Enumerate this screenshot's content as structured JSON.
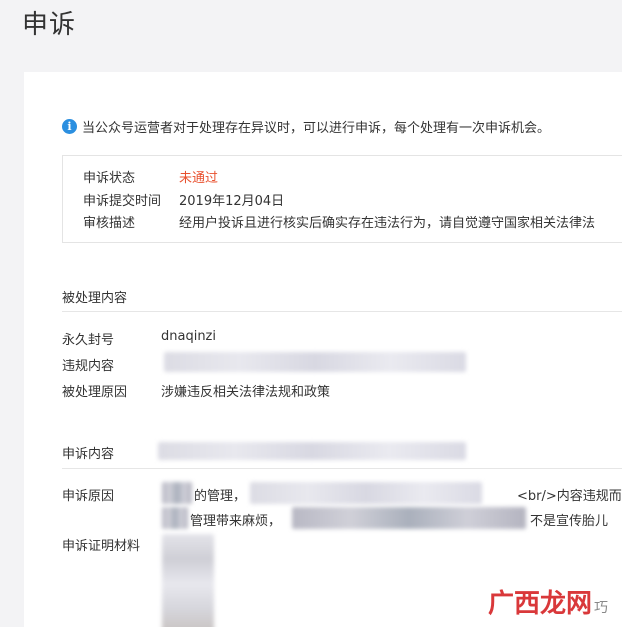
{
  "page": {
    "title": "申诉"
  },
  "notice": {
    "text": "当公众号运营者对于处理存在异议时，可以进行申诉，每个处理有一次申诉机会。"
  },
  "status_box": {
    "status_label": "申诉状态",
    "status_value": "未通过",
    "submit_time_label": "申诉提交时间",
    "submit_time_value": "2019年12月04日",
    "review_label": "审核描述",
    "review_value": "经用户投诉且进行核实后确实存在违法行为，请自觉遵守国家相关法律法"
  },
  "processed": {
    "section_title": "被处理内容",
    "ban_label": "永久封号",
    "ban_value": "dnaqinzi",
    "violation_label": "违规内容",
    "reason_label": "被处理原因",
    "reason_value": "涉嫌违反相关法律法规和政策"
  },
  "appeal": {
    "section_title": "申诉内容",
    "reason_label": "申诉原因",
    "reason_line1_a": "的管理，",
    "reason_line1_b": "<br/>内容违规而",
    "reason_line2_a": "管理带来麻烦，",
    "reason_line2_b": "不是宣传胎儿",
    "evidence_label": "申诉证明材料"
  },
  "watermark": {
    "logo": "广西龙网",
    "sub": "巧"
  },
  "colors": {
    "status_red": "#e8502e",
    "info_blue": "#2b8fe0",
    "watermark_red": "#d9383a"
  }
}
